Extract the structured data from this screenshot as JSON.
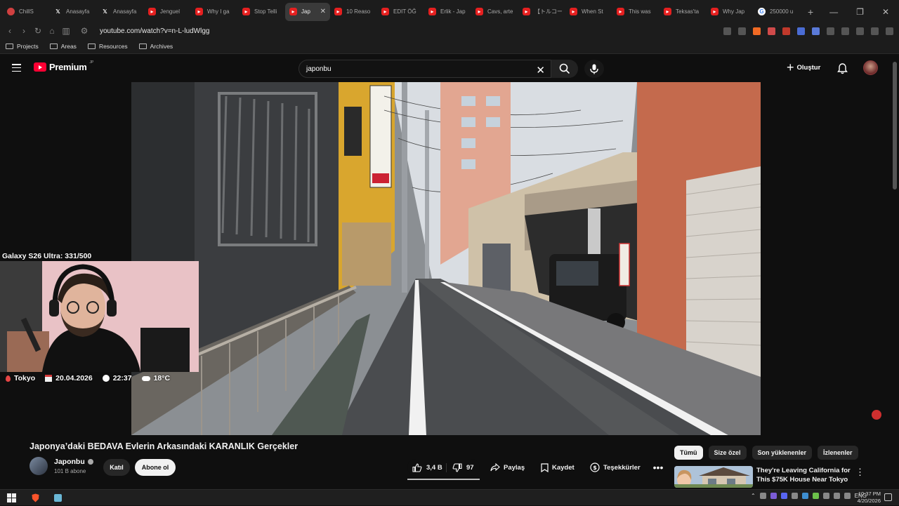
{
  "browser": {
    "tabs": [
      {
        "label": "ChillS",
        "fav": "chill"
      },
      {
        "label": "Anasayfa",
        "fav": "x"
      },
      {
        "label": "Anasayfa",
        "fav": "x"
      },
      {
        "label": "Jenguel",
        "fav": "yt"
      },
      {
        "label": "Why I ga",
        "fav": "yt"
      },
      {
        "label": "Stop Telli",
        "fav": "yt"
      },
      {
        "label": "Jap",
        "fav": "yt",
        "active": true
      },
      {
        "label": "10 Reaso",
        "fav": "yt"
      },
      {
        "label": "EDIT ÖĞ",
        "fav": "yt"
      },
      {
        "label": "Erlik - Jap",
        "fav": "yt"
      },
      {
        "label": "Cavs, arte",
        "fav": "yt"
      },
      {
        "label": "【トルコー",
        "fav": "yt"
      },
      {
        "label": "When St",
        "fav": "yt"
      },
      {
        "label": "This was",
        "fav": "yt"
      },
      {
        "label": "Teksas'ta",
        "fav": "yt"
      },
      {
        "label": "Why Jap",
        "fav": "yt"
      },
      {
        "label": "250000 u",
        "fav": "g"
      }
    ],
    "url": "youtube.com/watch?v=n-L-ludWlgg",
    "bookmarks": [
      "Projects",
      "Areas",
      "Resources",
      "Archives"
    ]
  },
  "youtube": {
    "logo_text": "Premium",
    "logo_region": "JP",
    "search_value": "japonbu",
    "create_label": "Oluştur"
  },
  "video": {
    "cam_label": "Galaxy S26 Ultra: 331/500",
    "location": "Tokyo",
    "date": "20.04.2026",
    "time": "22:37",
    "weather": "18°C",
    "title": "Japonya’daki BEDAVA Evlerin Arkasındaki KARANLIK Gerçekler",
    "channel_name": "Japonbu",
    "subscribers": "101 B abone",
    "join_label": "Katıl",
    "subscribe_label": "Abone ol",
    "likes": "3,4 B",
    "dislikes": "97",
    "share_label": "Paylaş",
    "save_label": "Kaydet",
    "thanks_label": "Teşekkürler",
    "more_label": "•••"
  },
  "chips": [
    "Tümü",
    "Size özel",
    "Son yüklenenler",
    "İzlenenler"
  ],
  "recommendation": {
    "title": "They're Leaving California for This $75K House Near Tokyo"
  },
  "taskbar": {
    "language": "ENG",
    "time": "10:37 PM",
    "date": "4/20/2026"
  },
  "colors": {
    "accent_red": "#ff0033",
    "background": "#0f0f0f"
  }
}
